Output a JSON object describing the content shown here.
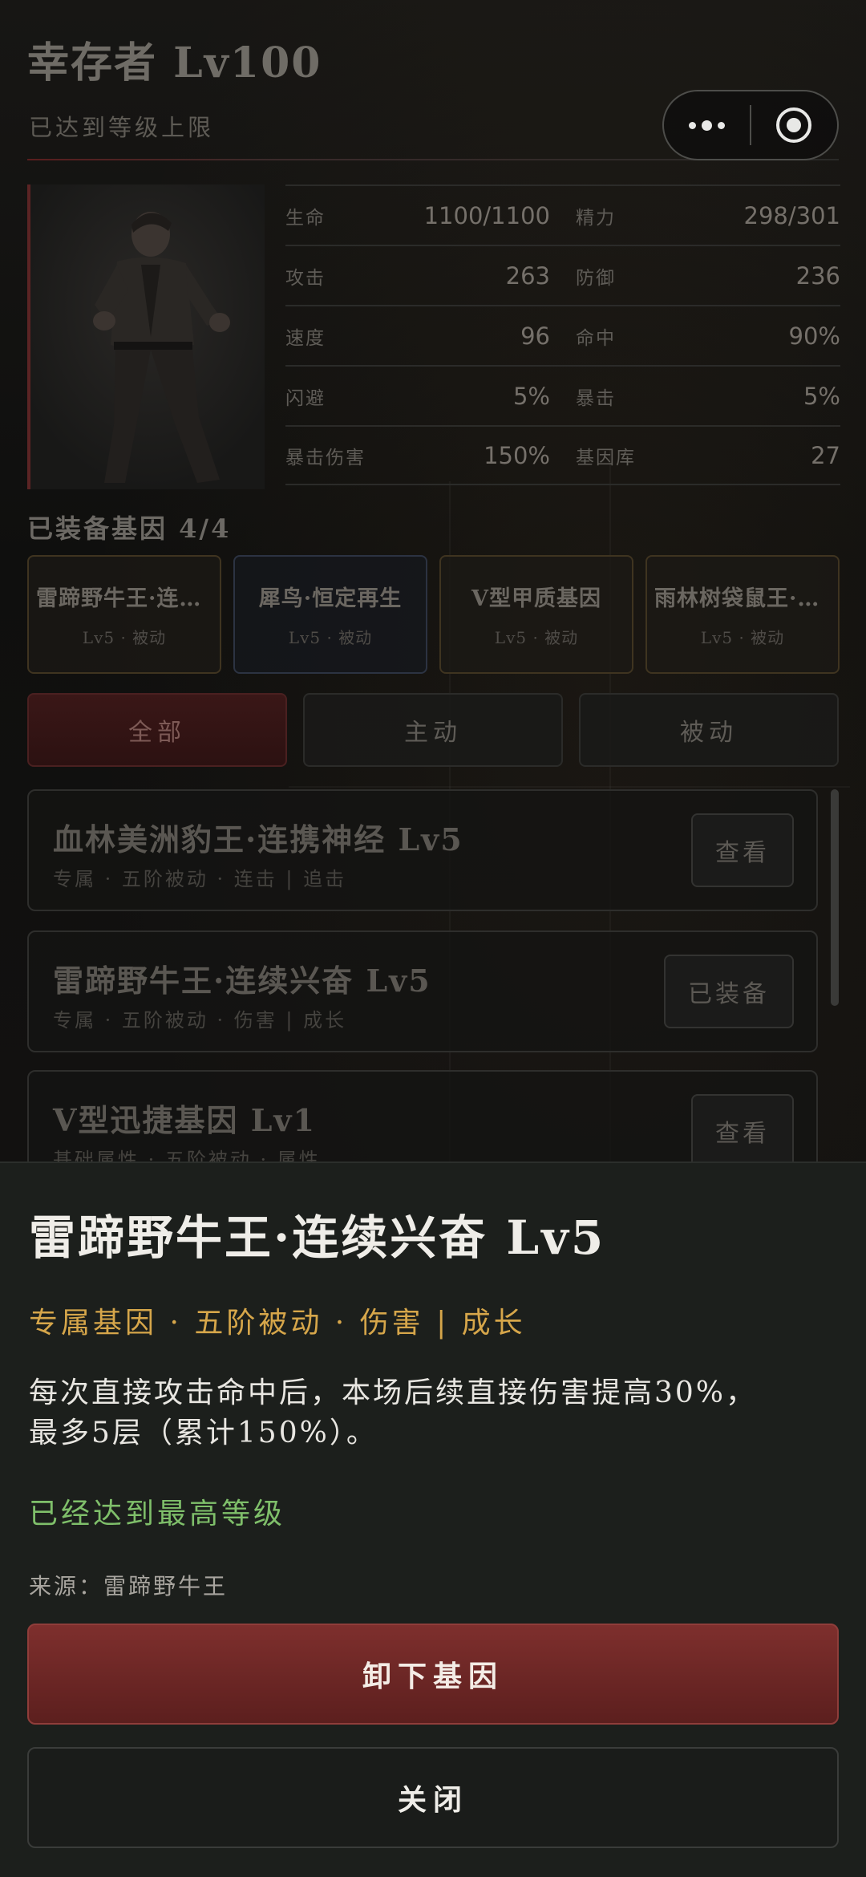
{
  "header": {
    "title": "幸存者 Lv100",
    "subtitle": "已达到等级上限"
  },
  "capsule": {
    "more_icon": "more-dots-icon",
    "close_icon": "target-circle-icon"
  },
  "stats": [
    {
      "label": "生命",
      "value": "1100/1100"
    },
    {
      "label": "精力",
      "value": "298/301"
    },
    {
      "label": "攻击",
      "value": "263"
    },
    {
      "label": "防御",
      "value": "236"
    },
    {
      "label": "速度",
      "value": "96"
    },
    {
      "label": "命中",
      "value": "90%"
    },
    {
      "label": "闪避",
      "value": "5%"
    },
    {
      "label": "暴击",
      "value": "5%"
    },
    {
      "label": "暴击伤害",
      "value": "150%"
    },
    {
      "label": "基因库",
      "value": "27"
    }
  ],
  "equipped": {
    "title": "已装备基因 4/4",
    "cards": [
      {
        "name": "雷蹄野牛王·连续兴奋",
        "sub": "Lv5 · 被动"
      },
      {
        "name": "犀鸟·恒定再生",
        "sub": "Lv5 · 被动"
      },
      {
        "name": "V型甲质基因",
        "sub": "Lv5 · 被动"
      },
      {
        "name": "雨林树袋鼠王·灵巧",
        "sub": "Lv5 · 被动"
      }
    ]
  },
  "tabs": [
    {
      "label": "全部"
    },
    {
      "label": "主动"
    },
    {
      "label": "被动"
    }
  ],
  "genes": [
    {
      "name": "血林美洲豹王·连携神经 Lv5",
      "tags": "专属 · 五阶被动 · 连击 | 追击",
      "button": "查看"
    },
    {
      "name": "雷蹄野牛王·连续兴奋 Lv5",
      "tags": "专属 · 五阶被动 · 伤害 | 成长",
      "button": "已装备"
    },
    {
      "name": "V型迅捷基因 Lv1",
      "tags": "基础属性 · 五阶被动 · 属性",
      "button": "查看"
    }
  ],
  "sheet": {
    "title": "雷蹄野牛王·连续兴奋 Lv5",
    "tags": "专属基因 · 五阶被动 · 伤害 | 成长",
    "desc_line1": "每次直接攻击命中后，本场后续直接伤害提高30%，",
    "desc_line2": "最多5层（累计150%）。",
    "status": "已经达到最高等级",
    "source": "来源：雷蹄野牛王",
    "primary_button": "卸下基因",
    "secondary_button": "关闭"
  },
  "colors": {
    "accent_red": "#7e2f2d",
    "tag_gold": "#d6a64a",
    "status_green": "#7fbf6a"
  }
}
